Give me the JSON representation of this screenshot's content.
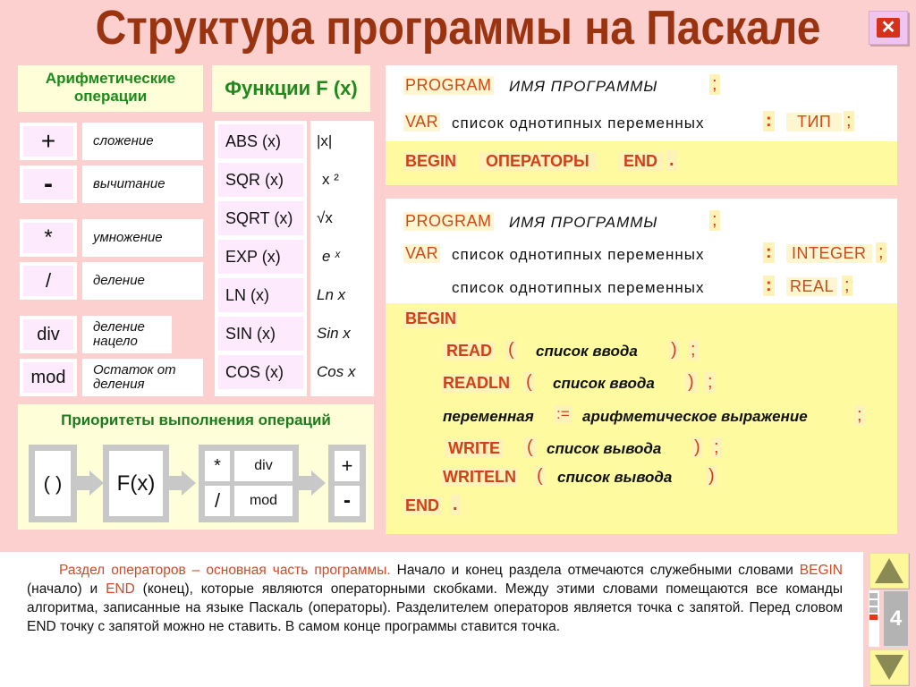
{
  "title": "Структура программы на Паскале",
  "close_icon": "close-icon",
  "arith": {
    "header": "Арифметические операции",
    "ops": [
      {
        "symbol": "+",
        "desc": "сложение"
      },
      {
        "symbol": "-",
        "desc": "вычитание"
      },
      {
        "symbol": "*",
        "desc": "умножение"
      },
      {
        "symbol": "/",
        "desc": "деление"
      },
      {
        "symbol": "div",
        "desc": "деление нацело"
      },
      {
        "symbol": "mod",
        "desc": "Остаток от деления"
      }
    ]
  },
  "functions": {
    "header": "Функции  F (x)",
    "items": [
      {
        "name": "ABS (x)",
        "math": "|x|"
      },
      {
        "name": "SQR (x)",
        "math": "x ²"
      },
      {
        "name": "SQRT (x)",
        "math": "√x"
      },
      {
        "name": "EXP (x)",
        "math": "e ˣ"
      },
      {
        "name": "LN (x)",
        "math": "Ln x"
      },
      {
        "name": "SIN (x)",
        "math": "Sin x"
      },
      {
        "name": "COS (x)",
        "math": "Cos x"
      }
    ]
  },
  "priority": {
    "title": "Приоритеты  выполнения  операций",
    "levels": [
      "( )",
      "F(x)",
      "*",
      "div",
      "/",
      "mod",
      "+",
      "-"
    ]
  },
  "code_general": {
    "program": "PROGRAM",
    "name": "ИМЯ  ПРОГРАММЫ",
    "semicolon": ";",
    "var": "VAR",
    "var_list": "список  однотипных  переменных",
    "colon": ":",
    "type": "ТИП",
    "begin": "BEGIN",
    "operators": "ОПЕРАТОРЫ",
    "end": "END",
    "dot": "."
  },
  "code_example": {
    "program": "PROGRAM",
    "name": "ИМЯ  ПРОГРАММЫ",
    "semicolon": ";",
    "var": "VAR",
    "var_list": "список  однотипных  переменных",
    "colon": ":",
    "type1": "INTEGER",
    "type2": "REAL",
    "begin": "BEGIN",
    "read": "READ",
    "readln": "READLN",
    "lparen": "(",
    "rparen": ")",
    "input_list": "список  ввода",
    "variable": "переменная",
    "assign": ":=",
    "expression": "арифметическое  выражение",
    "write": "WRITE",
    "writeln": "WRITELN",
    "output_list": "список  вывода",
    "end": "END",
    "dot": "."
  },
  "note": {
    "red_intro": "Раздел  операторов – основная  часть  программы.",
    "t1": " Начало  и  конец  раздела  отмечаются служебными словами ",
    "begin": "BEGIN",
    "t2": " (начало)  и ",
    "end": "END",
    "t3": " (конец), которые являются операторными скобками. Между этими словами  помещаются  все  команды  алгоритма,  записанные  на языке Паскаль (операторы). Разделителем  операторов  является  точка с запятой.  Перед  словом  END  точку  с запятой можно  не ставить. В самом конце программы ставится точка."
  },
  "nav": {
    "page_number": "4",
    "up_icon": "arrow-up-icon",
    "down_icon": "arrow-down-icon"
  }
}
